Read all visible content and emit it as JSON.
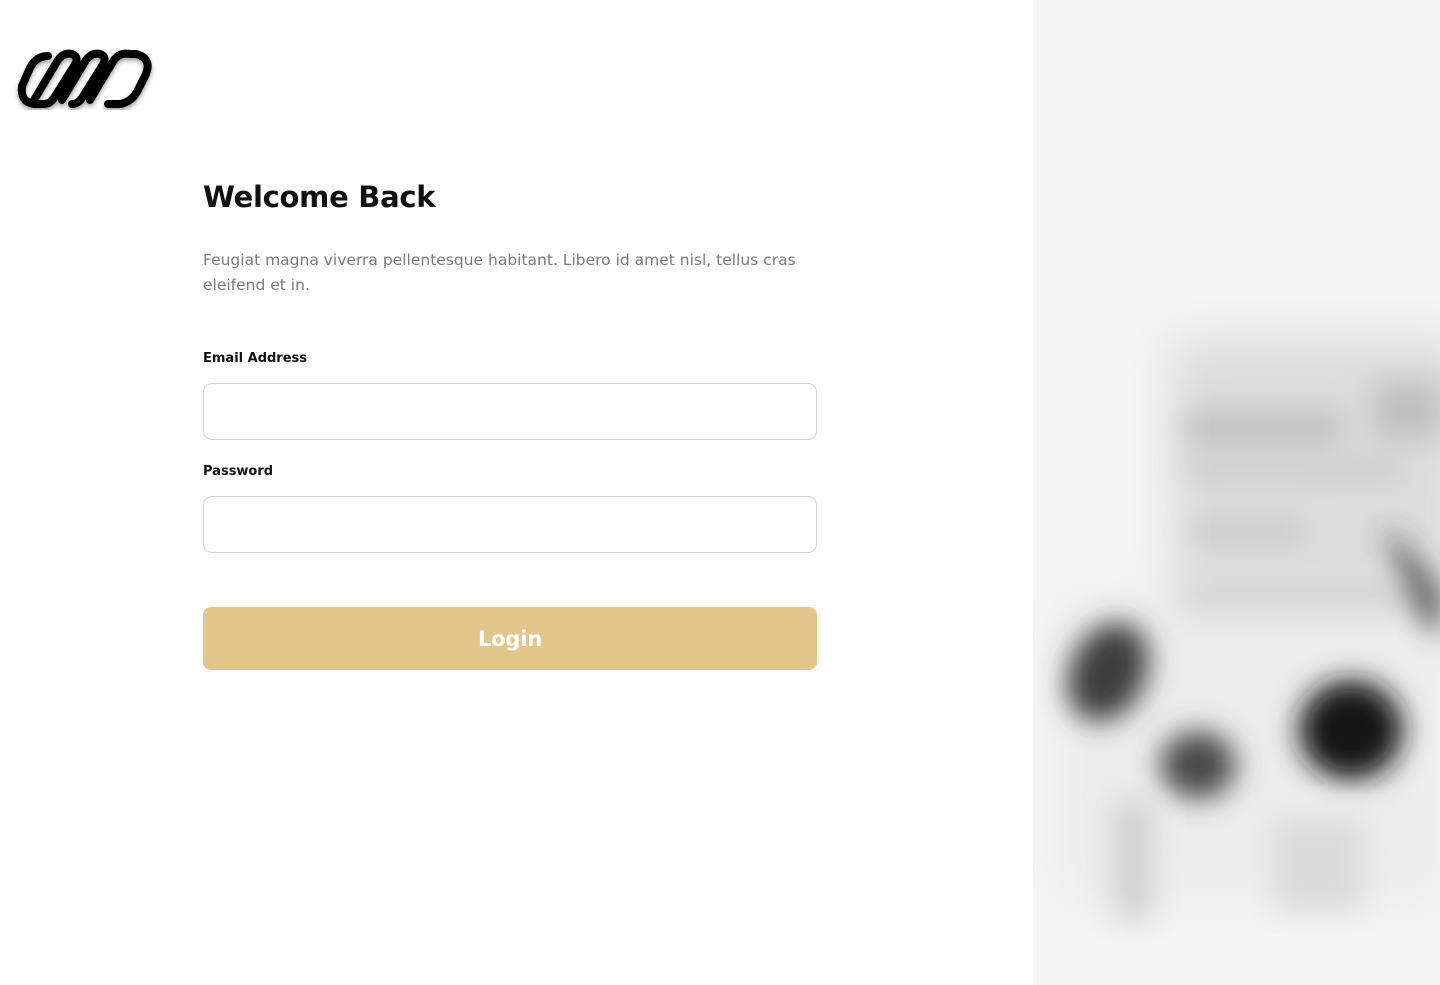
{
  "brand": {
    "logo_icon": "infinity-chain-icon"
  },
  "login": {
    "title": "Welcome Back",
    "subtitle": "Feugiat magna viverra pellentesque habitant. Libero id amet nisl, tellus cras eleifend et in.",
    "email_label": "Email Address",
    "email_value": "",
    "email_placeholder": "",
    "password_label": "Password",
    "password_value": "",
    "password_placeholder": "",
    "button_label": "Login"
  },
  "colors": {
    "accent": "#e3c68c",
    "right_panel_bg": "#f4f4f4"
  },
  "hero_image": {
    "description_icon": "blurred-photo"
  }
}
